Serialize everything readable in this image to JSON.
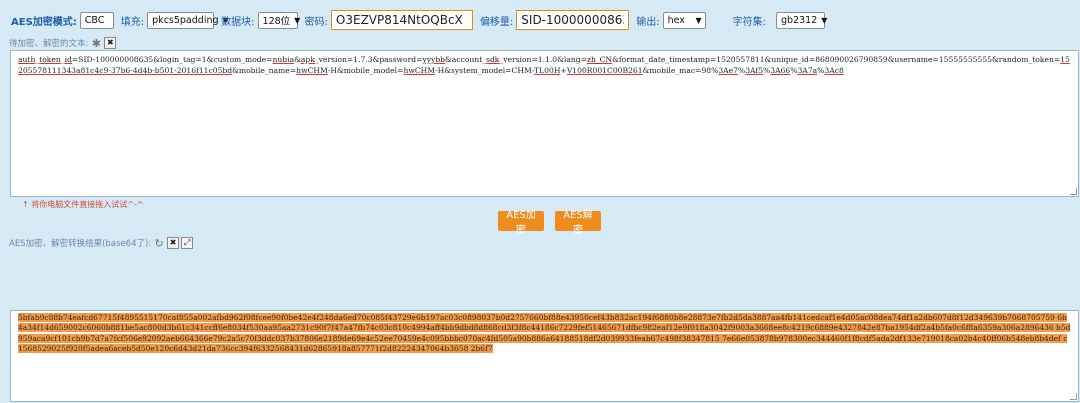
{
  "toolbar": {
    "mode_label": "AES加密模式:",
    "mode_value": "CBC",
    "padding_label": "填充:",
    "padding_value": "pkcs5padding",
    "block_label": "数据块:",
    "block_value": "128位",
    "key_label": "密码:",
    "key_value": "O3EZVP814NtOQBcX",
    "iv_label": "偏移量:",
    "iv_value": "SID-100000008635",
    "output_label": "输出:",
    "output_value": "hex",
    "charset_label": "字符集:",
    "charset_value": "gb2312"
  },
  "input_section": {
    "label": "待加密、解密的文本:",
    "close_icon": "✖",
    "text_parts": [
      {
        "t": "auth",
        "ul": true
      },
      {
        "t": "_",
        "ul": false
      },
      {
        "t": "token",
        "ul": true
      },
      {
        "t": "_",
        "ul": false
      },
      {
        "t": "id",
        "ul": true
      },
      {
        "t": "=SID-100000008635&login_tag=1&custom_mode=",
        "ul": false
      },
      {
        "t": "nubia",
        "ul": true
      },
      {
        "t": "&",
        "ul": false
      },
      {
        "t": "apk",
        "ul": true
      },
      {
        "t": "_version=1.7.3&password=",
        "ul": false
      },
      {
        "t": "yyybb",
        "ul": true
      },
      {
        "t": "&account_",
        "ul": false
      },
      {
        "t": "sdk",
        "ul": true
      },
      {
        "t": "_version=1.1.0&lang=",
        "ul": false
      },
      {
        "t": "zh_CN",
        "ul": true
      },
      {
        "t": "&format_date_timestamp=1520557811&unique_id=868090026790859&username=15555555555&random_token=",
        "ul": false
      },
      {
        "t": "15205578111343a81c4c9-37b6-4d4b-b501-2016f11c05bd",
        "ul": true
      },
      {
        "t": "&mobile_name=",
        "ul": false
      },
      {
        "t": "hwCHM",
        "ul": true
      },
      {
        "t": "-H&mobile_model=",
        "ul": false
      },
      {
        "t": "hwCHM",
        "ul": true
      },
      {
        "t": "-H&system_model=CHM-",
        "ul": false
      },
      {
        "t": "TL00H",
        "ul": true
      },
      {
        "t": "+",
        "ul": false
      },
      {
        "t": "V100R001C00B261",
        "ul": true
      },
      {
        "t": "&mobile_mac=98%",
        "ul": false
      },
      {
        "t": "3Ae7",
        "ul": true
      },
      {
        "t": "%",
        "ul": false
      },
      {
        "t": "3Af5",
        "ul": true
      },
      {
        "t": "%",
        "ul": false
      },
      {
        "t": "3A66",
        "ul": true
      },
      {
        "t": "%",
        "ul": false
      },
      {
        "t": "3A7a",
        "ul": true
      },
      {
        "t": "%",
        "ul": false
      },
      {
        "t": "3Ac8",
        "ul": true
      }
    ]
  },
  "hint": "↑ 将你电脑文件直接拖入试试^-^",
  "buttons": {
    "encrypt": "AES加密",
    "decrypt": "AES解密"
  },
  "output_section": {
    "label": "AES加密、解密转换结果(base64了):",
    "refresh_icon": "↻",
    "close_icon": "✖",
    "expand_icon": "⤢",
    "result": "5bfab9c88b74eafcd67715f4895515170caf855a002afbd962f08fcee90f0be42e4f248da6ed70c085f43729e6b197ac03c0898037b0d2757660bf88e43950cef43b832ac194f6880b8e28873e7fb2d5da3887aa4fb141cedcaf1e4d05ac08dea74df1a2db607d8f12d349639b7068705759 6b4a34f14d659002c6060b881be5ac800d3b61c341ccff6e8034f530aa95aa2731c90f7f47a47fb74c03c810c4994aff4bb9dbd8d868cd3f3f8c44186c7229fef51465671dfbc982eaf12e9f018a3042f9003a3668ee8c4219c6889e4327842e87ba1954df2a4b5fa0c6f8a6359a306a2896436 b5d959aca9cf101cb9b7d7a7fcf506e92092aeb664366e79c2a5c70f3ddc037b37806e2189de69e4c52ee70459e4c095bbbc070ac4fd505a90b886a64188518df2d039933feab67c498f38347815 7e66e053878b978300ec344460f1f8cdf5ada2df133e719018ca02b4c40ff06b548eb8b4def c1568529025f920f5adea6aceb5d50e120c6d43d21da736cc394f6332568431d62865918a857771f2d82224347064b3658 2b6f7"
  }
}
